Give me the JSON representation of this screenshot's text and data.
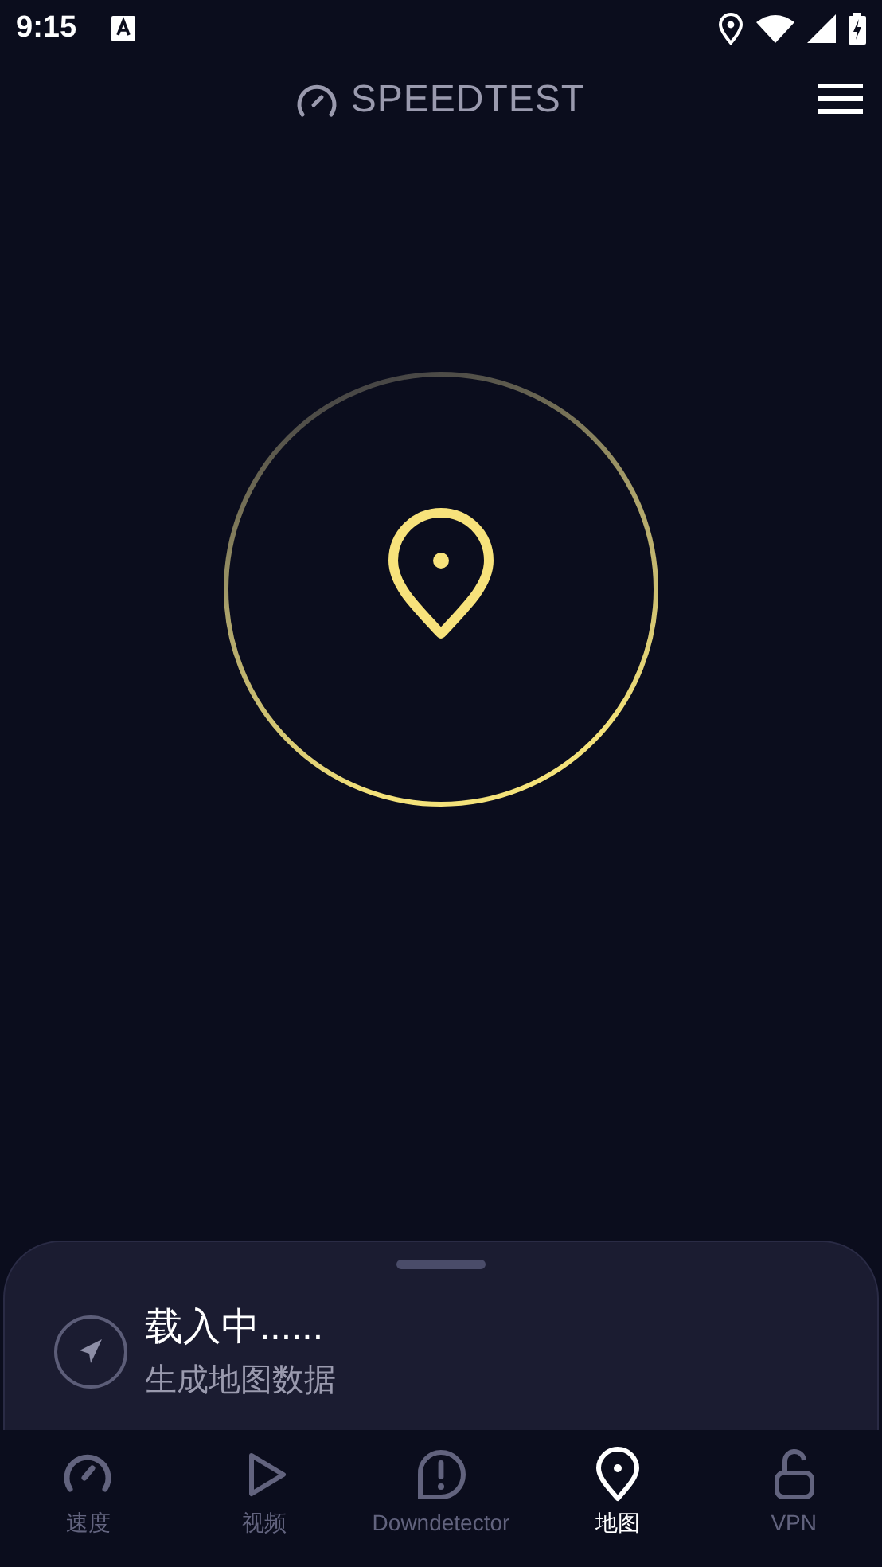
{
  "status_bar": {
    "time": "9:15"
  },
  "header": {
    "title": "SPEEDTEST"
  },
  "sheet": {
    "title": "载入中......",
    "subtitle": "生成地图数据"
  },
  "tabs": [
    {
      "kind": "speed",
      "label": "速度",
      "selected": false
    },
    {
      "kind": "video",
      "label": "视频",
      "selected": false
    },
    {
      "kind": "alert",
      "label": "Downdetector",
      "selected": false
    },
    {
      "kind": "map",
      "label": "地图",
      "selected": true
    },
    {
      "kind": "vpn",
      "label": "VPN",
      "selected": false
    }
  ]
}
